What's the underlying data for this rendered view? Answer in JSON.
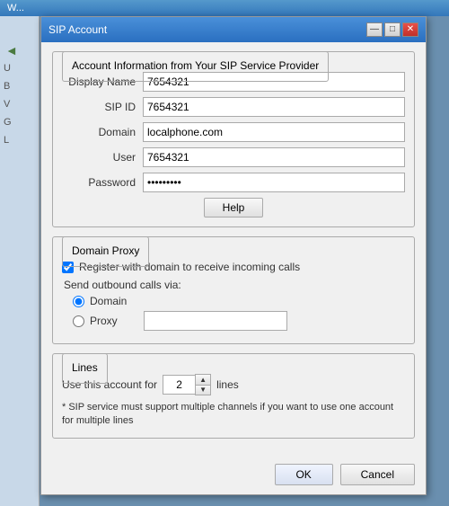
{
  "bgWindow": {
    "title": "W..."
  },
  "dialog": {
    "title": "SIP Account",
    "titlebarButtons": {
      "minimize": "—",
      "maximize": "□",
      "close": "✕"
    },
    "accountGroup": {
      "legend": "Account Information from Your SIP Service Provider",
      "fields": [
        {
          "label": "Display Name",
          "value": "7654321",
          "type": "text",
          "name": "display-name-input"
        },
        {
          "label": "SIP ID",
          "value": "7654321",
          "type": "text",
          "name": "sip-id-input"
        },
        {
          "label": "Domain",
          "value": "localphone.com",
          "type": "text",
          "name": "domain-input"
        },
        {
          "label": "User",
          "value": "7654321",
          "type": "text",
          "name": "user-input"
        },
        {
          "label": "Password",
          "value": "••••••••",
          "type": "password",
          "name": "password-input"
        }
      ],
      "helpButton": "Help"
    },
    "domainProxyGroup": {
      "legend": "Domain Proxy",
      "checkboxLabel": "Register with domain to receive incoming calls",
      "checkboxChecked": true,
      "sendLabel": "Send outbound calls via:",
      "radioOptions": [
        {
          "label": "Domain",
          "value": "domain",
          "checked": true,
          "name": "outbound-domain"
        },
        {
          "label": "Proxy",
          "value": "proxy",
          "checked": false,
          "name": "outbound-proxy"
        }
      ],
      "proxyInputValue": ""
    },
    "linesGroup": {
      "legend": "Lines",
      "prefixLabel": "Use this account for",
      "lineCount": "2",
      "suffixLabel": "lines",
      "note": "* SIP service must support multiple channels if you want to use one account for multiple lines"
    },
    "footer": {
      "okLabel": "OK",
      "cancelLabel": "Cancel"
    }
  },
  "leftStrip": {
    "items": [
      "U",
      "B",
      "V",
      "G",
      "L"
    ]
  }
}
